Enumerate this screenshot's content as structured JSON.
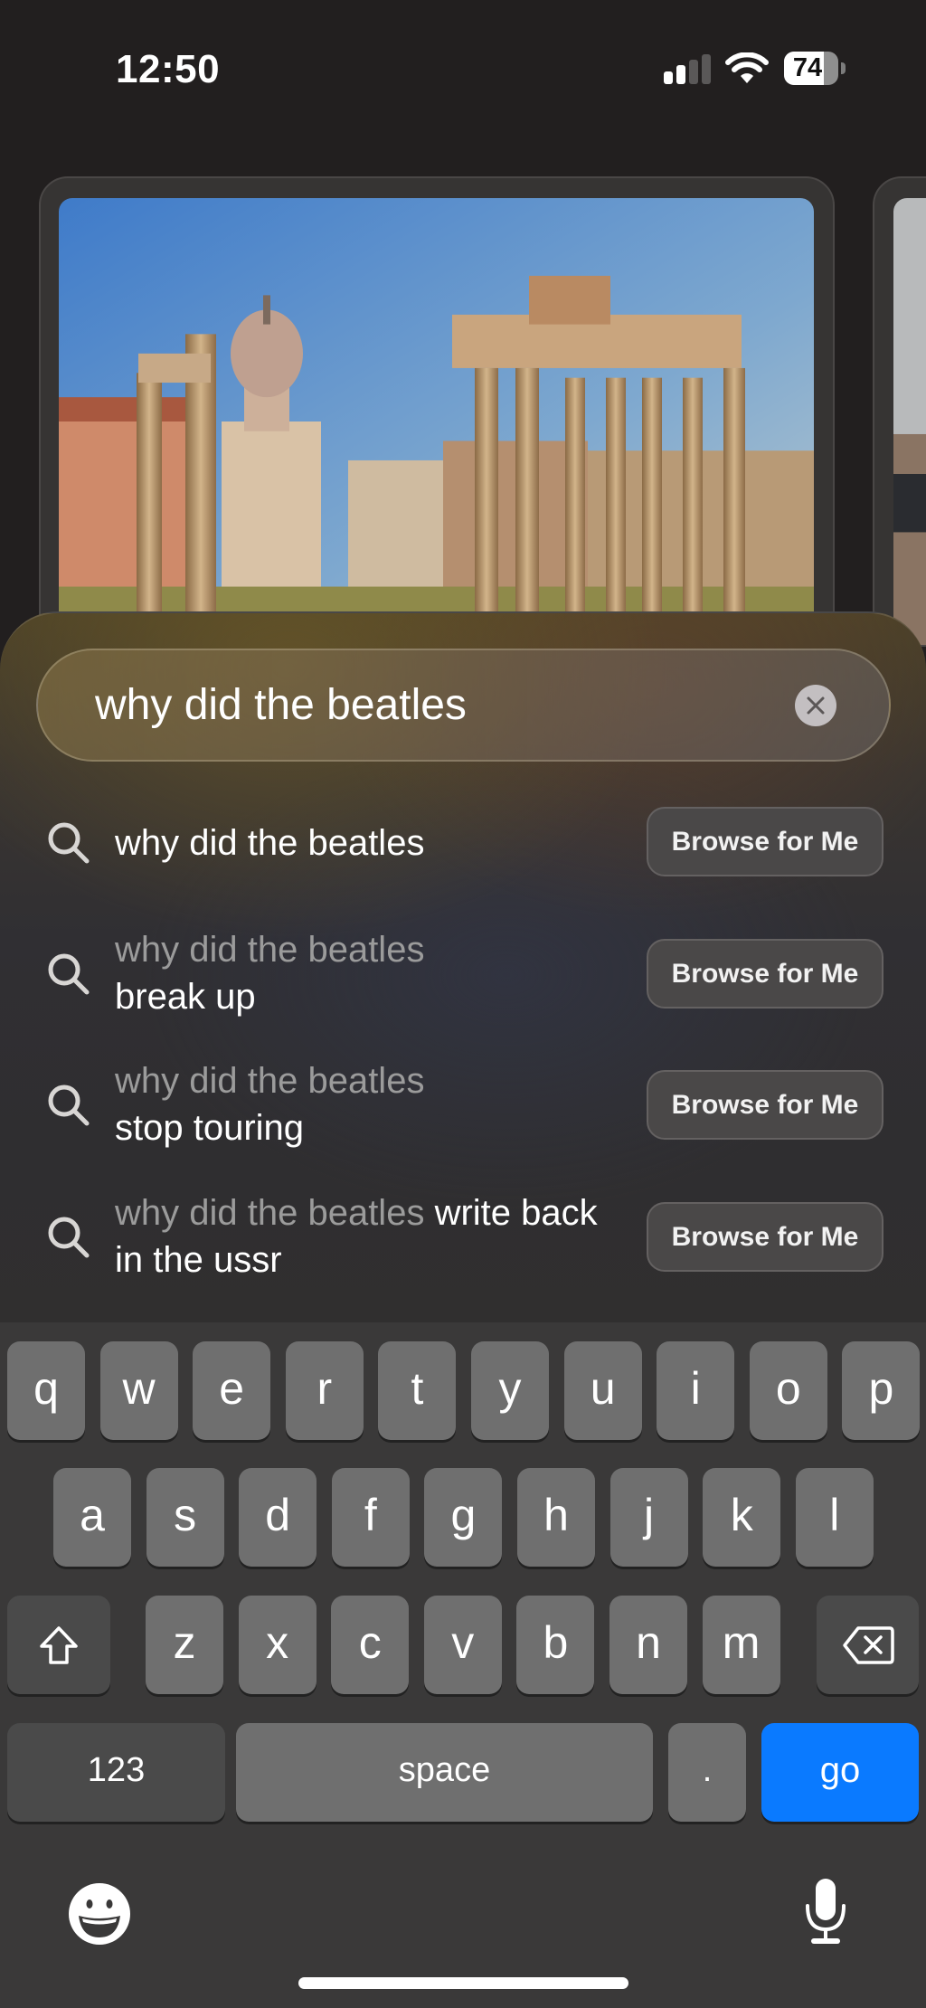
{
  "status_bar": {
    "time": "12:50",
    "signal_bars_active": 2,
    "signal_bars_total": 4,
    "wifi_icon": "wifi-icon",
    "battery_level": 74,
    "battery_text": "74"
  },
  "cards": [
    {
      "subject": "Roman Forum ruins with columns, arch and domed church",
      "icon": "photo-thumbnail"
    },
    {
      "subject": "Ancient stone ruin (partially visible)",
      "icon": "photo-thumbnail"
    }
  ],
  "search": {
    "value": "why did the beatles",
    "clear_icon": "clear-x-icon"
  },
  "suggestions": [
    {
      "prefix": "why did the beatles",
      "completion": "",
      "button": "Browse for Me",
      "icon": "search-icon"
    },
    {
      "prefix": "why did the beatles",
      "completion": "break up",
      "button": "Browse for Me",
      "icon": "search-icon"
    },
    {
      "prefix": "why did the beatles",
      "completion": "stop touring",
      "button": "Browse for Me",
      "icon": "search-icon"
    },
    {
      "prefix": "why did the beatles",
      "completion": "write back in the ussr",
      "button": "Browse for Me",
      "icon": "search-icon"
    }
  ],
  "keyboard": {
    "row1": [
      "q",
      "w",
      "e",
      "r",
      "t",
      "y",
      "u",
      "i",
      "o",
      "p"
    ],
    "row2": [
      "a",
      "s",
      "d",
      "f",
      "g",
      "h",
      "j",
      "k",
      "l"
    ],
    "row3": [
      "z",
      "x",
      "c",
      "v",
      "b",
      "n",
      "m"
    ],
    "shift_icon": "shift-arrow-icon",
    "delete_icon": "backspace-icon",
    "numbers_label": "123",
    "space_label": "space",
    "period_label": ".",
    "go_label": "go",
    "emoji_icon": "emoji-icon",
    "mic_icon": "microphone-icon"
  },
  "colors": {
    "accent": "#0a7aff",
    "key": "#6f6f6f",
    "key_dark": "#4a4a4a",
    "keyboard_bg": "#3a3939",
    "dim_text": "#9b9b9b"
  }
}
